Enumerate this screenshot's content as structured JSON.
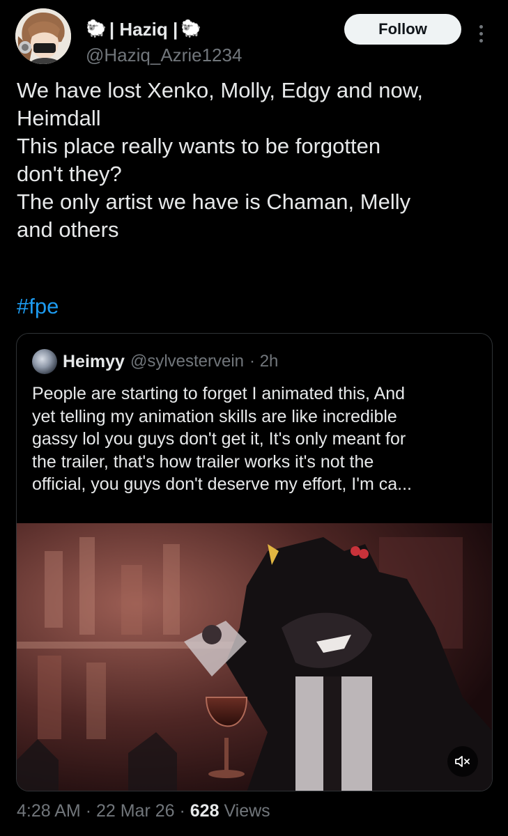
{
  "author": {
    "display_name": "| Haziq |",
    "left_emoji": "🐑",
    "right_emoji": "🐑",
    "handle": "@Haziq_Azrie1234",
    "avatar_icon": "user-avatar"
  },
  "actions": {
    "follow_label": "Follow",
    "more_icon": "more-vertical-icon"
  },
  "tweet": {
    "lines": [
      "We have lost Xenko, Molly, Edgy and now,",
      "Heimdall",
      "This place really wants to be forgotten",
      "don't they?",
      "The only artist we have is Chaman, Melly",
      "and others"
    ],
    "hashtag": "#fpe"
  },
  "quote": {
    "name": "Heimyy",
    "handle": "@sylvestervein",
    "time": "· 2h",
    "lines": [
      "People are starting to forget I animated this, And",
      "yet telling my animation skills are like incredible",
      "gassy lol  you guys don't get it, It's only meant for",
      "the trailer,  that's how trailer works it's not the",
      "official, you guys don't deserve my effort, I'm ca..."
    ],
    "media_icon": "video-thumbnail",
    "mute_icon": "speaker-muted-icon"
  },
  "meta": {
    "time": "4:28 AM",
    "separator": "·",
    "date": "22 Mar 26",
    "views_count": "628",
    "views_label": "Views"
  },
  "colors": {
    "background": "#000000",
    "text": "#e7e9ea",
    "secondary_text": "#71767b",
    "link": "#1d9bf0",
    "follow_bg": "#eff3f4",
    "border": "#2f3336"
  }
}
